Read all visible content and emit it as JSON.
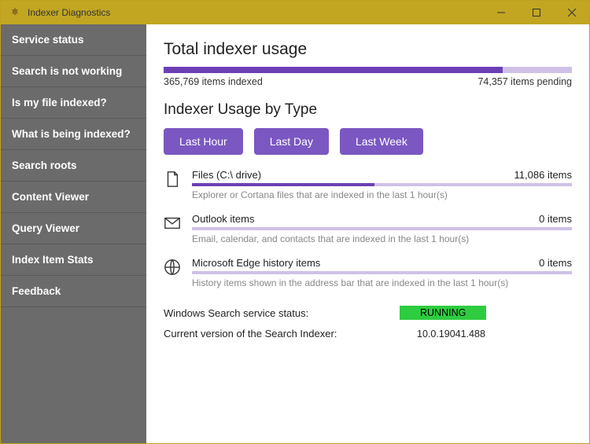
{
  "window": {
    "title": "Indexer Diagnostics"
  },
  "sidebar": {
    "items": [
      {
        "label": "Service status"
      },
      {
        "label": "Search is not working"
      },
      {
        "label": "Is my file indexed?"
      },
      {
        "label": "What is being indexed?"
      },
      {
        "label": "Search roots"
      },
      {
        "label": "Content Viewer"
      },
      {
        "label": "Query Viewer"
      },
      {
        "label": "Index Item Stats"
      },
      {
        "label": "Feedback"
      }
    ]
  },
  "main": {
    "total_title": "Total indexer usage",
    "total_indexed": "365,769 items indexed",
    "total_pending": "74,357 items pending",
    "usage_title": "Indexer Usage by Type",
    "buttons": {
      "last_hour": "Last Hour",
      "last_day": "Last Day",
      "last_week": "Last Week"
    },
    "types": [
      {
        "icon": "file-icon",
        "name": "Files (C:\\ drive)",
        "count": "11,086 items",
        "desc": "Explorer or Cortana files that are indexed in the last 1 hour(s)"
      },
      {
        "icon": "mail-icon",
        "name": "Outlook items",
        "count": "0 items",
        "desc": "Email, calendar, and contacts that are indexed in the last 1 hour(s)"
      },
      {
        "icon": "globe-icon",
        "name": "Microsoft Edge history items",
        "count": "0 items",
        "desc": "History items shown in the address bar that are indexed in the last 1 hour(s)"
      }
    ],
    "status": {
      "service_label": "Windows Search service status:",
      "service_value": "RUNNING",
      "version_label": "Current version of the Search Indexer:",
      "version_value": "10.0.19041.488"
    }
  },
  "chart_data": {
    "total_usage": {
      "type": "bar",
      "title": "Total indexer usage",
      "categories": [
        "indexed",
        "pending"
      ],
      "values": [
        365769,
        74357
      ],
      "xlabel": "",
      "ylabel": "items"
    },
    "usage_by_type": {
      "type": "bar",
      "title": "Indexer Usage by Type (Last Hour)",
      "categories": [
        "Files (C:\\ drive)",
        "Outlook items",
        "Microsoft Edge history items"
      ],
      "values": [
        11086,
        0,
        0
      ],
      "ylabel": "items",
      "ylim": [
        0,
        11086
      ]
    }
  }
}
